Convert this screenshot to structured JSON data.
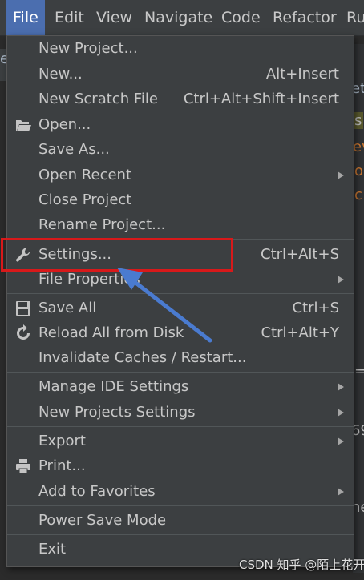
{
  "menubar": {
    "items": [
      {
        "label": "File"
      },
      {
        "label": "Edit"
      },
      {
        "label": "View"
      },
      {
        "label": "Navigate"
      },
      {
        "label": "Code"
      },
      {
        "label": "Refactor"
      },
      {
        "label": "Ru"
      }
    ]
  },
  "background_fragments": {
    "left_top": "e",
    "right_1": "et",
    "right_2": "s",
    "right_3": "ev",
    "right_4": "o",
    "right_5": "c",
    "right_6": "=",
    "right_7": "69",
    "right_8": "ne"
  },
  "file_menu": {
    "items": [
      {
        "label": "New Project...",
        "shortcut": ""
      },
      {
        "label": "New...",
        "shortcut": "Alt+Insert"
      },
      {
        "label": "New Scratch File",
        "shortcut": "Ctrl+Alt+Shift+Insert"
      },
      {
        "label": "Open...",
        "shortcut": "",
        "icon": "folder-open-icon"
      },
      {
        "label": "Save As...",
        "shortcut": ""
      },
      {
        "label": "Open Recent",
        "shortcut": "",
        "submenu": true
      },
      {
        "label": "Close Project",
        "shortcut": ""
      },
      {
        "label": "Rename Project...",
        "shortcut": ""
      },
      {
        "label": "Settings...",
        "shortcut": "Ctrl+Alt+S",
        "icon": "wrench-icon"
      },
      {
        "label": "File Properties",
        "shortcut": "",
        "submenu": true
      },
      {
        "label": "Save All",
        "shortcut": "Ctrl+S",
        "icon": "save-icon"
      },
      {
        "label": "Reload All from Disk",
        "shortcut": "Ctrl+Alt+Y",
        "icon": "reload-icon"
      },
      {
        "label": "Invalidate Caches / Restart...",
        "shortcut": ""
      },
      {
        "label": "Manage IDE Settings",
        "shortcut": "",
        "submenu": true
      },
      {
        "label": "New Projects Settings",
        "shortcut": "",
        "submenu": true
      },
      {
        "label": "Export",
        "shortcut": "",
        "submenu": true
      },
      {
        "label": "Print...",
        "shortcut": "",
        "icon": "print-icon"
      },
      {
        "label": "Add to Favorites",
        "shortcut": "",
        "submenu": true
      },
      {
        "label": "Power Save Mode",
        "shortcut": ""
      },
      {
        "label": "Exit",
        "shortcut": ""
      }
    ]
  },
  "annotations": {
    "highlight_color": "#d8191a",
    "arrow_color": "#4a7bd0"
  },
  "watermark": "CSDN 知乎 @陌上花开",
  "colors": {
    "menu_bg": "#3c3f41",
    "menubar_active": "#4b6eaf",
    "editor_bg": "#2b2b2b"
  }
}
